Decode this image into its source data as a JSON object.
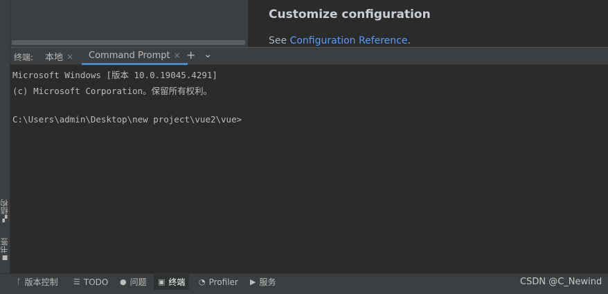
{
  "left_tools": [
    {
      "label": "结构",
      "icon": "structure-icon"
    },
    {
      "label": "书签",
      "icon": "bookmark-icon"
    }
  ],
  "doc": {
    "heading": "Customize configuration",
    "see_prefix": "See ",
    "link_text": "Configuration Reference",
    "see_suffix": "."
  },
  "terminal": {
    "title": "终端:",
    "tabs": [
      {
        "label": "本地",
        "active": false
      },
      {
        "label": "Command Prompt",
        "active": true
      }
    ],
    "close_glyph": "×",
    "add_glyph": "+",
    "more_glyph": "⌄",
    "lines": [
      "Microsoft Windows [版本 10.0.19045.4291]",
      "(c) Microsoft Corporation。保留所有权利。",
      "",
      "C:\\Users\\admin\\Desktop\\new project\\vue2\\vue>"
    ]
  },
  "status_bar": {
    "items": [
      {
        "label": "版本控制",
        "icon": "branch-icon",
        "active": false
      },
      {
        "label": "TODO",
        "icon": "list-icon",
        "active": false
      },
      {
        "label": "问题",
        "icon": "problem-icon",
        "active": false
      },
      {
        "label": "终端",
        "icon": "terminal-icon",
        "active": true
      },
      {
        "label": "Profiler",
        "icon": "profiler-icon",
        "active": false
      },
      {
        "label": "服务",
        "icon": "services-icon",
        "active": false
      }
    ],
    "watermark": "CSDN @C_Newind"
  },
  "colors": {
    "link": "#589df6",
    "tab_underline": "#4a88c7",
    "panel": "#3c3f41",
    "editor": "#2b2b2b"
  }
}
